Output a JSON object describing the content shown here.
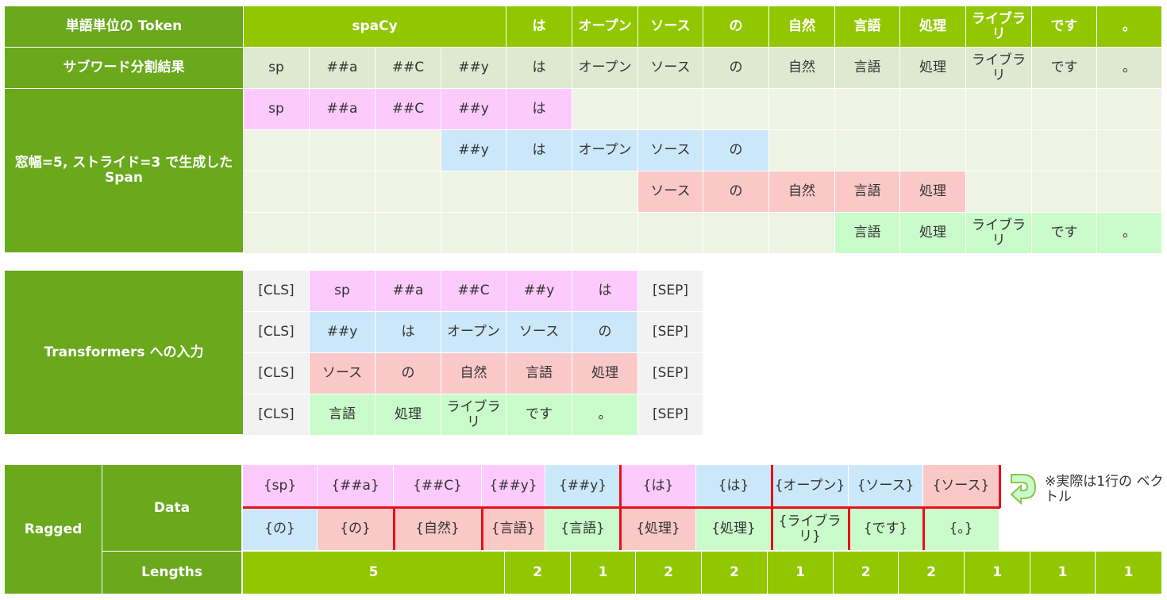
{
  "section1": {
    "header_label": "単語単位の Token",
    "header_tokens": [
      "spaCy",
      "は",
      "オープン",
      "ソース",
      "の",
      "自然",
      "言語",
      "処理",
      "ライブラリ",
      "です",
      "。"
    ],
    "subword_label": "サブワード分割結果",
    "subwords": [
      "sp",
      "##a",
      "##C",
      "##y",
      "は",
      "オープン",
      "ソース",
      "の",
      "自然",
      "言語",
      "処理",
      "ライブラリ",
      "です",
      "。"
    ],
    "span_label": "窓幅=5, ストライド=3 で生成した Span",
    "spans": [
      {
        "color": "#fdcafd",
        "tokens": [
          "sp",
          "##a",
          "##C",
          "##y",
          "は"
        ]
      },
      {
        "color": "#cbe8fb",
        "tokens": [
          "##y",
          "は",
          "オープン",
          "ソース",
          "の"
        ]
      },
      {
        "color": "#fbc8c8",
        "tokens": [
          "ソース",
          "の",
          "自然",
          "言語",
          "処理"
        ]
      },
      {
        "color": "#c9fcca",
        "tokens": [
          "言語",
          "処理",
          "ライブラリ",
          "です",
          "。"
        ]
      }
    ]
  },
  "section2": {
    "label": "Transformers への入力",
    "cls": "[CLS]",
    "sep": "[SEP]",
    "rows": [
      [
        "sp",
        "##a",
        "##C",
        "##y",
        "は"
      ],
      [
        "##y",
        "は",
        "オープン",
        "ソース",
        "の"
      ],
      [
        "ソース",
        "の",
        "自然",
        "言語",
        "処理"
      ],
      [
        "言語",
        "処理",
        "ライブラリ",
        "です",
        "。"
      ]
    ]
  },
  "section3": {
    "label": "Ragged",
    "data_label": "Data",
    "lengths_label": "Lengths",
    "data_row1": [
      "{sp}",
      "{##a}",
      "{##C}",
      "{##y}",
      "{##y}",
      "{は}",
      "{は}",
      "{オープン}",
      "{ソース}",
      "{ソース}"
    ],
    "data_row2": [
      "{の}",
      "{の}",
      "{自然}",
      "{言語}",
      "{言語}",
      "{処理}",
      "{処理}",
      "{ライブラリ}",
      "{です}",
      "{。}"
    ],
    "lengths": [
      "5",
      "2",
      "1",
      "2",
      "2",
      "1",
      "2",
      "2",
      "1",
      "1",
      "1"
    ],
    "note": "※実際は1行の ベクトル",
    "arrow_icon": "u-turn-arrow-icon"
  }
}
